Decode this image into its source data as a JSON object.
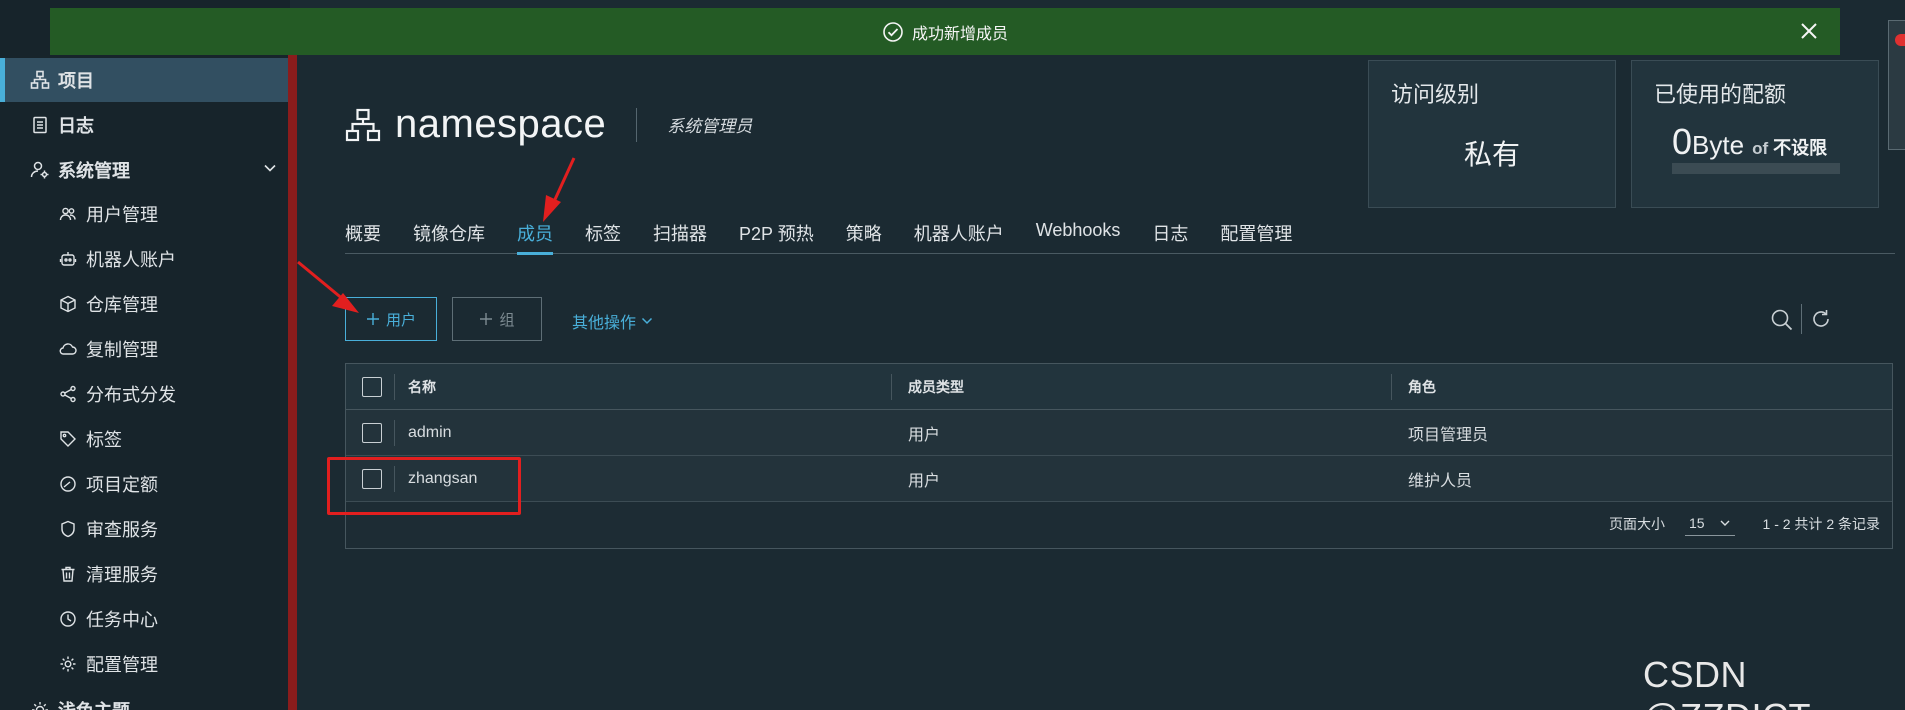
{
  "toast": {
    "message": "成功新增成员"
  },
  "sidebar": {
    "items": [
      {
        "label": "项目",
        "icon": "project-icon"
      },
      {
        "label": "日志",
        "icon": "log-icon"
      },
      {
        "label": "系统管理",
        "icon": "admin-icon"
      },
      {
        "label": "用户管理",
        "icon": "users-icon"
      },
      {
        "label": "机器人账户",
        "icon": "robot-icon"
      },
      {
        "label": "仓库管理",
        "icon": "cube-icon"
      },
      {
        "label": "复制管理",
        "icon": "cloud-icon"
      },
      {
        "label": "分布式分发",
        "icon": "share-icon"
      },
      {
        "label": "标签",
        "icon": "tag-icon"
      },
      {
        "label": "项目定额",
        "icon": "dashboard-icon"
      },
      {
        "label": "审查服务",
        "icon": "shield-icon"
      },
      {
        "label": "清理服务",
        "icon": "trash-icon"
      },
      {
        "label": "任务中心",
        "icon": "clock-icon"
      },
      {
        "label": "配置管理",
        "icon": "gear-icon"
      },
      {
        "label": "浅色主题",
        "icon": "sun-icon"
      }
    ]
  },
  "header": {
    "project_name": "namespace",
    "role": "系统管理员"
  },
  "cards": {
    "access": {
      "label": "访问级别",
      "value": "私有"
    },
    "quota": {
      "label": "已使用的配额",
      "used": "0",
      "unit": "Byte",
      "of": "of",
      "limit": "不设限"
    }
  },
  "tabs": [
    {
      "label": "概要"
    },
    {
      "label": "镜像仓库"
    },
    {
      "label": "成员"
    },
    {
      "label": "标签"
    },
    {
      "label": "扫描器"
    },
    {
      "label": "P2P 预热"
    },
    {
      "label": "策略"
    },
    {
      "label": "机器人账户"
    },
    {
      "label": "Webhooks"
    },
    {
      "label": "日志"
    },
    {
      "label": "配置管理"
    }
  ],
  "actions": {
    "add_user": "用户",
    "add_group": "组",
    "more": "其他操作"
  },
  "table": {
    "columns": [
      "名称",
      "成员类型",
      "角色"
    ],
    "rows": [
      {
        "name": "admin",
        "type": "用户",
        "role": "项目管理员"
      },
      {
        "name": "zhangsan",
        "type": "用户",
        "role": "维护人员"
      }
    ],
    "footer": {
      "page_size_label": "页面大小",
      "page_size": "15",
      "summary": "1 - 2 共计 2 条记录"
    }
  },
  "watermark": "CSDN @ZZDICT",
  "colors": {
    "accent": "#49afd9",
    "toast": "#245b25",
    "annotation": "#e21f1f",
    "sidebar_divider": "#8a1c1c"
  }
}
